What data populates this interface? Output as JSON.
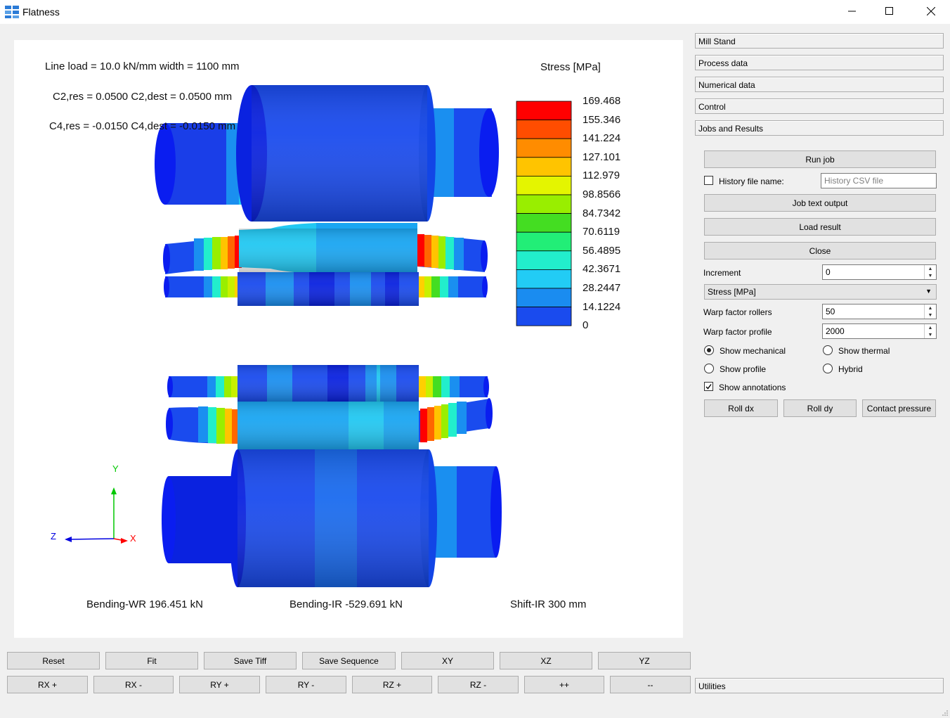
{
  "window": {
    "title": "Flatness",
    "minimize_icon": "minimize-icon",
    "maximize_icon": "maximize-icon",
    "close_icon": "close-icon"
  },
  "viewport": {
    "line_load": "Line load = 10.0 kN/mm  width = 1100 mm",
    "c2": "C2,res = 0.0500  C2,dest = 0.0500 mm",
    "c4": "C4,res = -0.0150  C4,dest = -0.0150 mm",
    "legend_title": "Stress [MPa]",
    "legend_values": [
      "169.468",
      "155.346",
      "141.224",
      "127.101",
      "112.979",
      "98.8566",
      "84.7342",
      "70.6119",
      "56.4895",
      "42.3671",
      "28.2447",
      "14.1224",
      "0"
    ],
    "legend_colors": [
      "#ff0000",
      "#ff4d00",
      "#ff8c00",
      "#ffc400",
      "#e4f500",
      "#99ee00",
      "#44dd22",
      "#22ee77",
      "#22eecc",
      "#22ccf5",
      "#1a8cf0",
      "#1a4bee",
      "#0a1af5"
    ],
    "bending_wr": "Bending-WR 196.451 kN",
    "bending_ir": "Bending-IR -529.691 kN",
    "shift_ir": "Shift-IR 300 mm",
    "axis_y": "Y",
    "axis_z": "Z",
    "axis_x": "X"
  },
  "panel": {
    "sections": [
      "Mill Stand",
      "Process data",
      "Numerical data",
      "Control",
      "Jobs and Results"
    ],
    "run_job": "Run job",
    "history_label": "History file name:",
    "history_placeholder": "History CSV file",
    "job_text_output": "Job text output",
    "load_result": "Load result",
    "close": "Close",
    "increment_label": "Increment",
    "increment_value": "0",
    "result_select": "Stress [MPa]",
    "warp_rollers_label": "Warp factor rollers",
    "warp_rollers_value": "50",
    "warp_profile_label": "Warp factor profile",
    "warp_profile_value": "2000",
    "show_mechanical": "Show mechanical",
    "show_thermal": "Show thermal",
    "show_profile": "Show profile",
    "hybrid": "Hybrid",
    "show_annotations": "Show annotations",
    "roll_dx": "Roll dx",
    "roll_dy": "Roll dy",
    "contact_pressure": "Contact pressure",
    "utilities": "Utilities"
  },
  "toolbar": {
    "row1": [
      "Reset",
      "Fit",
      "Save Tiff",
      "Save Sequence",
      "XY",
      "XZ",
      "YZ"
    ],
    "row2": [
      "RX +",
      "RX -",
      "RY +",
      "RY -",
      "RZ +",
      "RZ -",
      "++",
      "--"
    ]
  }
}
